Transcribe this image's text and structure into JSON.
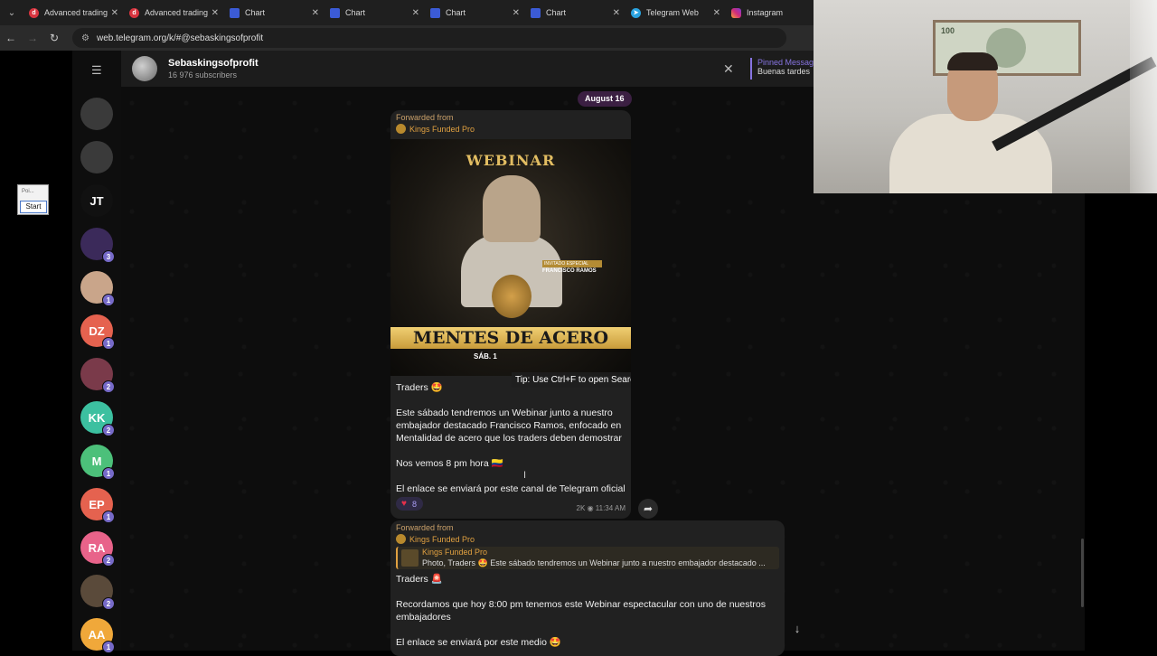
{
  "browser": {
    "tabs": [
      {
        "title": "Advanced trading",
        "icon": "d-icon",
        "kind": "d"
      },
      {
        "title": "Advanced trading",
        "icon": "d-icon",
        "kind": "d"
      },
      {
        "title": "Chart",
        "icon": "chart-icon",
        "kind": "chart"
      },
      {
        "title": "Chart",
        "icon": "chart-icon",
        "kind": "chart"
      },
      {
        "title": "Chart",
        "icon": "chart-icon",
        "kind": "chart"
      },
      {
        "title": "Chart",
        "icon": "chart-icon",
        "kind": "chart"
      },
      {
        "title": "Telegram Web",
        "icon": "telegram-icon",
        "kind": "tg"
      },
      {
        "title": "Instagram",
        "icon": "instagram-icon",
        "kind": "ig"
      }
    ],
    "url": "web.telegram.org/k/#@sebaskingsofprofit"
  },
  "widget": {
    "input_placeholder": "Poi...",
    "start_label": "Start"
  },
  "chat_list": {
    "avatars": [
      {
        "initials": "",
        "badge": "",
        "color": "#3a3a3a"
      },
      {
        "initials": "",
        "badge": "",
        "color": "#3a3a3a"
      },
      {
        "initials": "JT",
        "badge": "",
        "color": "#111111"
      },
      {
        "initials": "",
        "badge": "3",
        "color": "#3b2a5a"
      },
      {
        "initials": "",
        "badge": "1",
        "color": "#c9a58a"
      },
      {
        "initials": "DZ",
        "badge": "1",
        "color": "#e5624f"
      },
      {
        "initials": "",
        "badge": "2",
        "color": "#7a3a4a"
      },
      {
        "initials": "KK",
        "badge": "2",
        "color": "#3cc0a0"
      },
      {
        "initials": "M",
        "badge": "1",
        "color": "#4cc07a"
      },
      {
        "initials": "EP",
        "badge": "1",
        "color": "#e5624f"
      },
      {
        "initials": "RA",
        "badge": "2",
        "color": "#e8638a"
      },
      {
        "initials": "",
        "badge": "2",
        "color": "#5a4a3a"
      },
      {
        "initials": "AA",
        "badge": "1",
        "color": "#f0a83a"
      }
    ]
  },
  "chat": {
    "title": "Sebaskingsofprofit",
    "subscribers": "16 976 subscribers",
    "pinned_title": "Pinned Message",
    "pinned_body": "Buenas tardes",
    "date_pill": "August 16"
  },
  "message1": {
    "forwarded_label": "Forwarded from",
    "forwarded_from": "Kings Funded Pro",
    "image": {
      "title": "WEBINAR",
      "guest_tag": "INVITADO ESPECIAL",
      "guest_name": "FRANCISCO RAMOS",
      "banner": "MENTES DE ACERO",
      "date_text": "SÁB. 1"
    },
    "tooltip": "Tip: Use Ctrl+F to open Search",
    "paragraphs": [
      "Traders 🤩",
      "Este sábado tendremos un Webinar junto a nuestro embajador destacado Francisco Ramos, enfocado en Mentalidad de acero que los traders deben demostrar",
      "Nos vemos 8 pm hora 🇨🇴",
      "El enlace se enviará por este canal de Telegram oficial"
    ],
    "reaction_count": "8",
    "views": "2K",
    "time": "11:34 AM"
  },
  "message2": {
    "forwarded_label": "Forwarded from",
    "forwarded_from": "Kings Funded Pro",
    "quote_title": "Kings Funded Pro",
    "quote_body": "Photo, Traders 🤩 Este sábado tendremos un Webinar junto a nuestro embajador destacado ...",
    "paragraphs": [
      "Traders 🚨",
      "Recordamos que hoy 8:00 pm tenemos este Webinar espectacular con uno de nuestros embajadores",
      "El enlace se enviará por este medio 🤩"
    ]
  },
  "webcam": {
    "bill_text": "100"
  },
  "colors": {
    "accent": "#8774e1",
    "forward": "#e0a040",
    "heart": "#e8304a"
  }
}
